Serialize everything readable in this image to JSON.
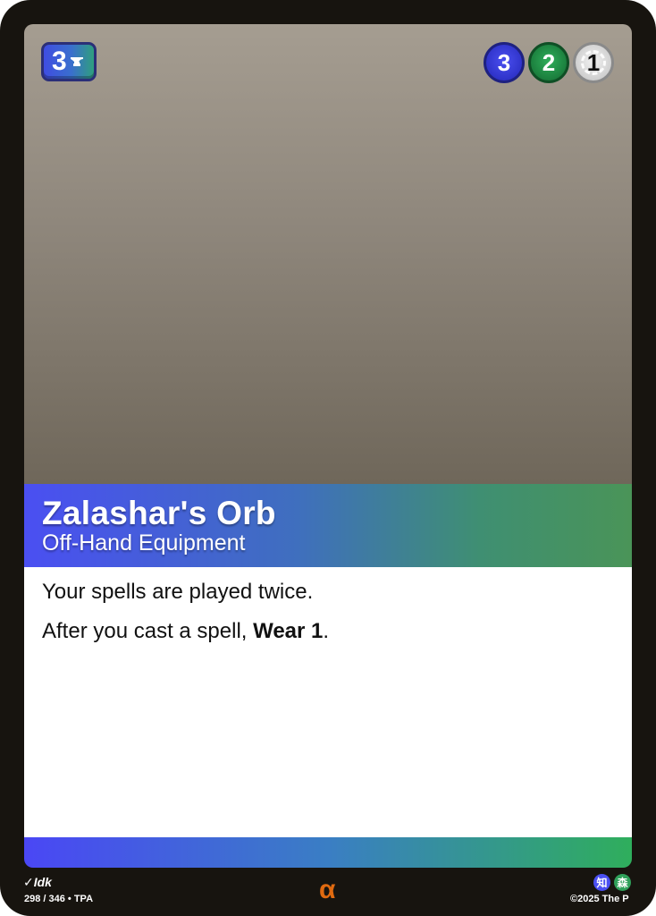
{
  "cost": {
    "value": "3",
    "icon": "anvil-icon",
    "colors": [
      "#3f4de2",
      "#2f9e7e"
    ]
  },
  "stat_pips": [
    {
      "value": "3",
      "color": "#3a3fde"
    },
    {
      "value": "2",
      "color": "#1f8a45"
    },
    {
      "value": "1",
      "color": "#e0e0e0"
    }
  ],
  "card": {
    "name": "Zalashar's Orb",
    "type": "Off-Hand Equipment",
    "rules": {
      "line1": "Your spells are played twice.",
      "line2_prefix": "After you cast a spell, ",
      "line2_bold": "Wear 1",
      "line2_suffix": "."
    }
  },
  "footer": {
    "artist": "Idk",
    "collector": "298 / 346 • TPA",
    "rarity_symbol": "α",
    "faction_glyphs": [
      "知",
      "森"
    ],
    "copyright": "©2025 The P"
  },
  "colors": {
    "frame": "#17140f",
    "rarity": "#e06a10",
    "faction_blue": "#4a4ff2",
    "faction_green": "#2fa05a"
  }
}
